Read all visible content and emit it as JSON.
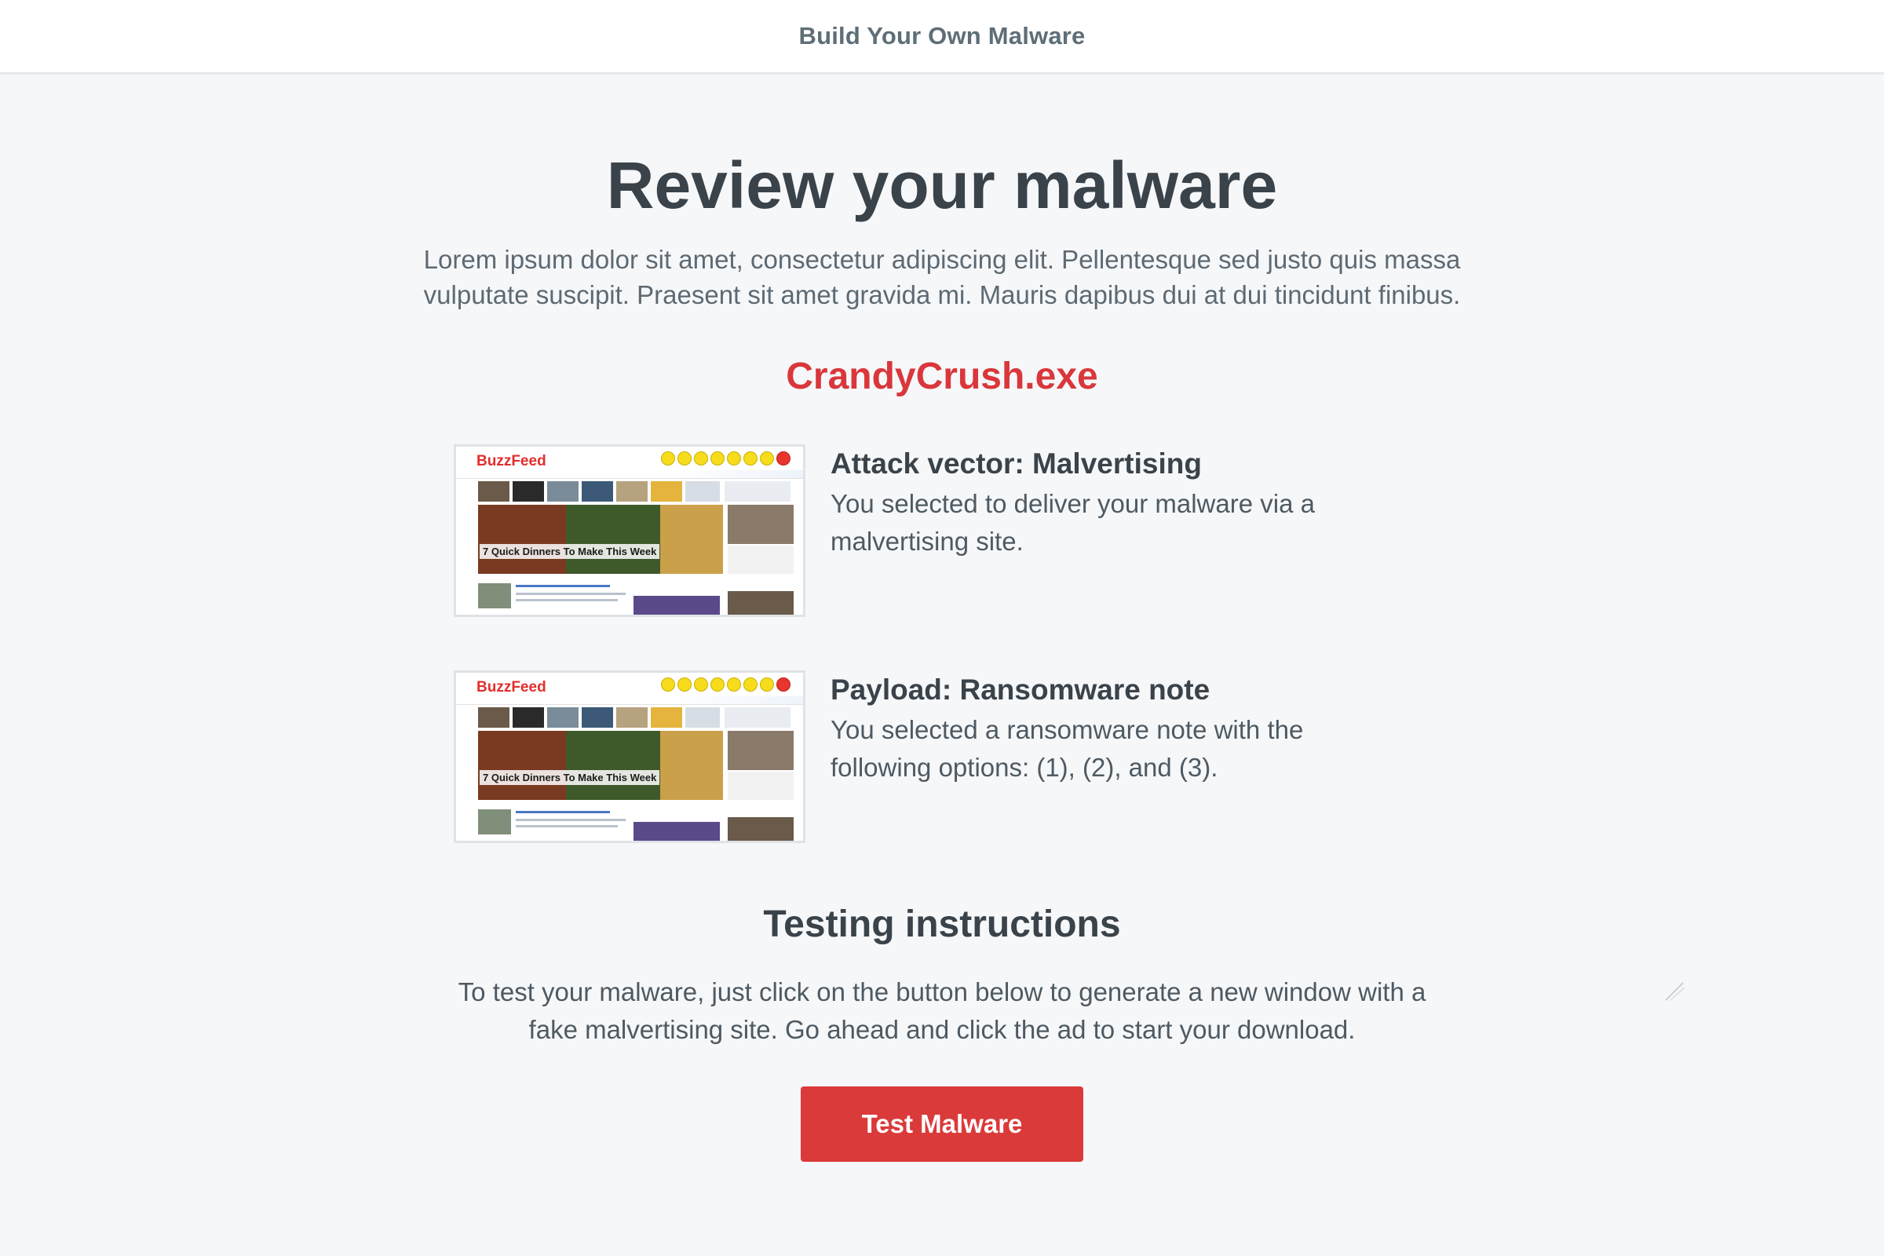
{
  "header": {
    "title": "Build Your Own Malware"
  },
  "main": {
    "title": "Review your malware",
    "intro": "Lorem ipsum dolor sit amet, consectetur adipiscing elit. Pellentesque sed justo quis massa vulputate suscipit. Praesent sit amet gravida mi. Mauris dapibus dui at dui tincidunt finibus.",
    "malware_name": "CrandyCrush.exe",
    "summary": [
      {
        "heading": "Attack vector: Malvertising",
        "text": "You selected to deliver your malware via a malvertising site.",
        "thumb_logo": "BuzzFeed",
        "thumb_headline": "7 Quick Dinners To Make This Week"
      },
      {
        "heading": "Payload: Ransomware note",
        "text": "You selected a ransomware note with the following options: (1), (2), and (3).",
        "thumb_logo": "BuzzFeed",
        "thumb_headline": "7 Quick Dinners To Make This Week"
      }
    ],
    "testing": {
      "title": "Testing instructions",
      "text": "To test your malware, just click on the button below to generate a new window with a fake malvertising site. Go ahead and click the ad to start your download.",
      "button_label": "Test Malware"
    }
  },
  "colors": {
    "accent": "#db3a3a",
    "malware_name": "#d9373b",
    "page_background": "#f6f7f9"
  },
  "icons": [
    "pencil-icon"
  ]
}
